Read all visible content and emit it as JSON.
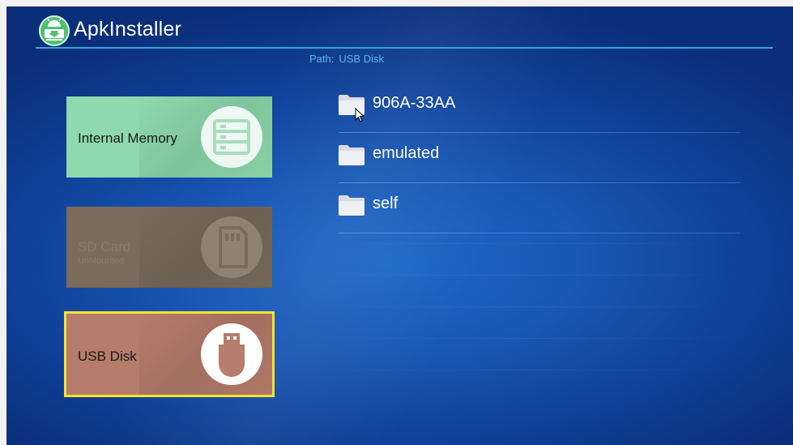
{
  "app": {
    "title": "ApkInstaller",
    "logo_icon": "android-installer-icon"
  },
  "path": {
    "label": "Path:",
    "value": "USB Disk"
  },
  "storage": [
    {
      "name": "Internal Memory",
      "subtitle": "",
      "icon": "storage-server-icon",
      "color": "#8ed9ad",
      "state": "available"
    },
    {
      "name": "SD Card",
      "subtitle": "UnMounted",
      "icon": "sd-card-icon",
      "color": "#7a6b5a",
      "state": "unmounted"
    },
    {
      "name": "USB Disk",
      "subtitle": "",
      "icon": "usb-disk-icon",
      "color": "#b67c6c",
      "state": "selected"
    }
  ],
  "files": [
    {
      "name": "906A-33AA",
      "icon": "folder-icon"
    },
    {
      "name": "emulated",
      "icon": "folder-icon"
    },
    {
      "name": "self",
      "icon": "folder-icon"
    }
  ],
  "colors": {
    "background": "#1858b6",
    "header_line": "#36a3d9",
    "path_text": "#5fb3ee",
    "selection_border": "#f5e22c"
  }
}
